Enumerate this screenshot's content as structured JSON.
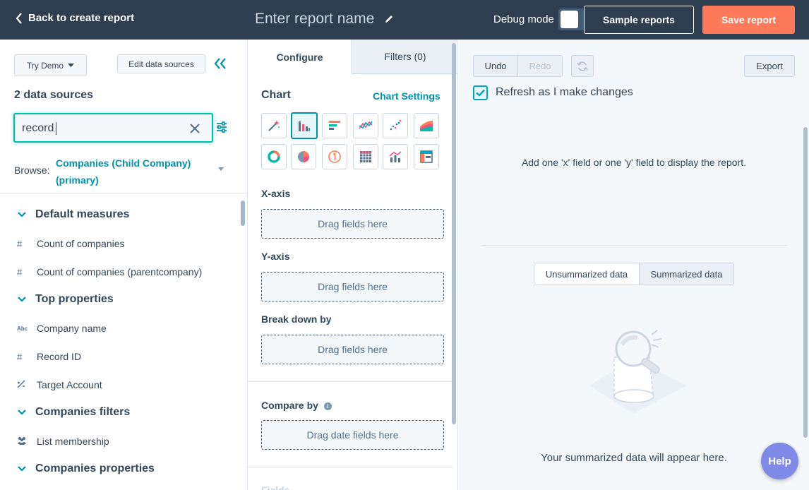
{
  "header": {
    "back_label": "Back to create report",
    "report_name_placeholder": "Enter report name",
    "debug_label": "Debug mode",
    "sample_reports": "Sample reports",
    "save_report": "Save report"
  },
  "left": {
    "try_demo": "Try Demo",
    "edit_sources": "Edit data sources",
    "source_count": "2 data sources",
    "search_value": "record",
    "browse_label": "Browse:",
    "browse_value": "Companies (Child Company) (primary)",
    "tree": {
      "default_measures": "Default measures",
      "count_companies": "Count of companies",
      "count_parent": "Count of companies (parentcompany)",
      "top_properties": "Top properties",
      "company_name": "Company name",
      "record_id": "Record ID",
      "target_account": "Target Account",
      "companies_filters": "Companies filters",
      "list_membership": "List membership",
      "companies_properties": "Companies properties"
    }
  },
  "middle": {
    "tab_configure": "Configure",
    "tab_filters": "Filters (0)",
    "chart_label": "Chart",
    "chart_settings": "Chart Settings",
    "x_axis": "X-axis",
    "y_axis": "Y-axis",
    "break_down": "Break down by",
    "compare_by": "Compare by",
    "drag_fields": "Drag fields here",
    "drag_date_fields": "Drag date fields here",
    "cut_text": "Fields"
  },
  "right": {
    "undo": "Undo",
    "redo": "Redo",
    "export": "Export",
    "refresh_label": "Refresh as I make changes",
    "empty_msg": "Add one 'x' field or one 'y' field to display the report.",
    "unsummarized": "Unsummarized data",
    "summarized": "Summarized data",
    "summarized_msg": "Your summarized data will appear here.",
    "help": "Help"
  },
  "colors": {
    "header_bg": "#2d3e50",
    "accent": "#0091ae",
    "save_btn": "#ff7a59",
    "help_btn": "#7e8ae6"
  }
}
